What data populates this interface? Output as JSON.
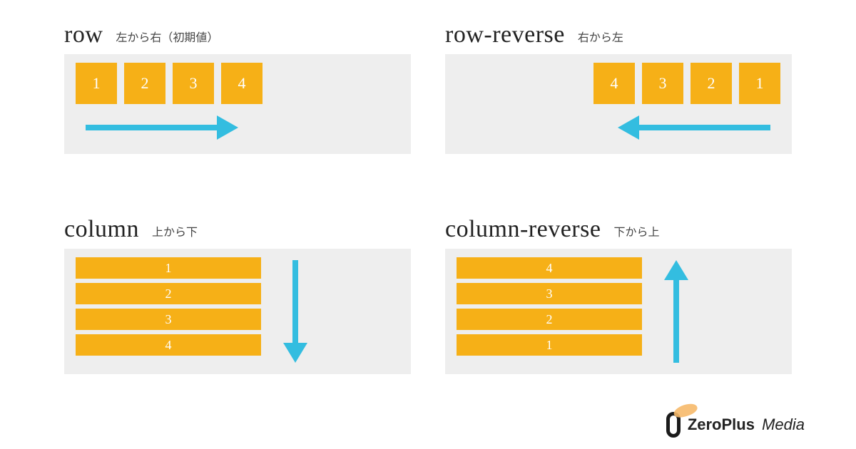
{
  "colors": {
    "box": "#f6b017",
    "panel": "#eeeeee",
    "arrow": "#33bde0"
  },
  "quadrants": {
    "row": {
      "title": "row",
      "sub": "左から右（初期値）",
      "items": [
        "1",
        "2",
        "3",
        "4"
      ],
      "arrow": "right"
    },
    "row_reverse": {
      "title": "row-reverse",
      "sub": "右から左",
      "items": [
        "4",
        "3",
        "2",
        "1"
      ],
      "arrow": "left"
    },
    "column": {
      "title": "column",
      "sub": "上から下",
      "items": [
        "1",
        "2",
        "3",
        "4"
      ],
      "arrow": "down"
    },
    "column_reverse": {
      "title": "column-reverse",
      "sub": "下から上",
      "items": [
        "4",
        "3",
        "2",
        "1"
      ],
      "arrow": "up"
    }
  },
  "brand": {
    "name": "ZeroPlus",
    "suffix": "Media"
  }
}
